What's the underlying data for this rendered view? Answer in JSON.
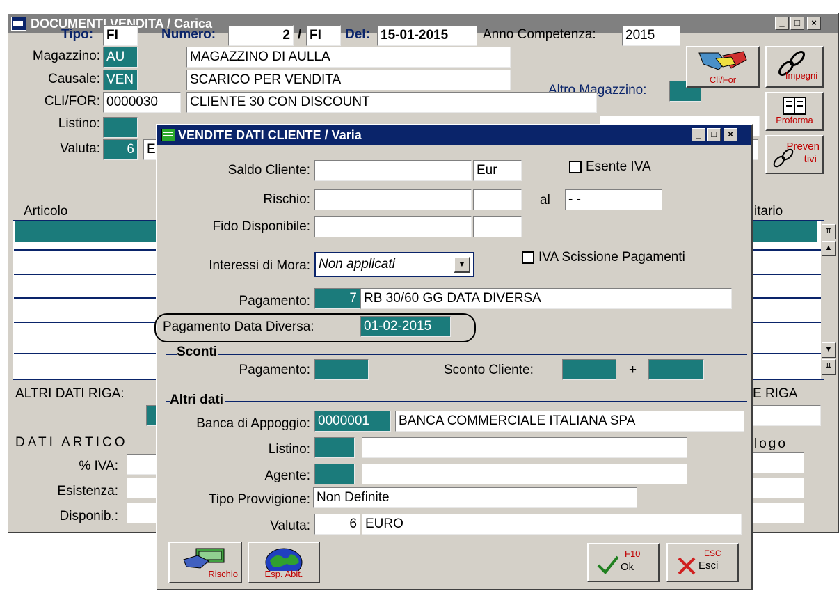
{
  "back": {
    "title": "DOCUMENTI VENDITA / Carica",
    "tipo_label": "Tipo:",
    "tipo_value": "FI",
    "numero_label": "Numero:",
    "numero_value": "2",
    "numero_sep": "/",
    "numero_series": "FI",
    "del_label": "Del:",
    "del_value": "15-01-2015",
    "anno_label": "Anno Competenza:",
    "anno_value": "2015",
    "magazzino_label": "Magazzino:",
    "magazzino_code": "AU",
    "magazzino_desc": "MAGAZZINO DI AULLA",
    "causale_label": "Causale:",
    "causale_code": "VEN",
    "causale_desc": "SCARICO PER VENDITA",
    "altro_magazzino_label": "Altro Magazzino:",
    "clifor_label": "CLI/FOR:",
    "clifor_code": "0000030",
    "clifor_desc": "CLIENTE 30 CON DISCOUNT",
    "listino_label": "Listino:",
    "valuta_label": "Valuta:",
    "valuta_code": "6",
    "valuta_desc": "E",
    "articolo_col": "Articolo",
    "unitario_col": "itario",
    "altri_dati_riga": "ALTRI DATI RIGA:",
    "e_riga": "E RIGA",
    "dati_articolo": "DATI ARTICO",
    "catalogo": "logo",
    "iva_label": "% IVA:",
    "esistenza_label": "Esistenza:",
    "disponib_label": "Disponib.:",
    "btn_clifor": "Cli/For",
    "btn_impegni": "Impegni",
    "btn_proforma": "Proforma",
    "btn_preventivi_1": "Preven",
    "btn_preventivi_2": "tivi"
  },
  "dialog": {
    "title": "VENDITE DATI CLIENTE / Varia",
    "saldo_label": "Saldo Cliente:",
    "saldo_value": "",
    "saldo_currency": "Eur",
    "esente_iva_label": "Esente IVA",
    "rischio_label": "Rischio:",
    "rischio_value": "",
    "al_label": "al",
    "al_value": "- -",
    "fido_label": "Fido Disponibile:",
    "interessi_label": "Interessi di Mora:",
    "interessi_value": "Non applicati",
    "iva_scissione_label": "IVA Scissione Pagamenti",
    "pagamento_label": "Pagamento:",
    "pagamento_code": "7",
    "pagamento_desc": "RB 30/60 GG DATA DIVERSA",
    "pag_data_diversa_label": "Pagamento Data Diversa:",
    "pag_data_diversa_value": "01-02-2015",
    "sconti_group": "Sconti",
    "sconto_pagamento_label": "Pagamento:",
    "sconto_cliente_label": "Sconto Cliente:",
    "plus": "+",
    "altri_dati_group": "Altri dati",
    "banca_label": "Banca di Appoggio:",
    "banca_code": "0000001",
    "banca_desc": "BANCA COMMERCIALE ITALIANA SPA",
    "listino_label": "Listino:",
    "agente_label": "Agente:",
    "tipo_provv_label": "Tipo Provvigione:",
    "tipo_provv_value": "Non Definite",
    "valuta_label": "Valuta:",
    "valuta_code": "6",
    "valuta_desc": "EURO",
    "btn_rischio": "Rischio",
    "btn_esp_abit": "Esp. Abit.",
    "btn_ok_key": "F10",
    "btn_ok_label": "Ok",
    "btn_esci_key": "ESC",
    "btn_esci_label": "Esci"
  },
  "colors": {
    "teal": "#1b7b7b",
    "title_active": "#0a246a",
    "title_inactive": "#808080"
  }
}
